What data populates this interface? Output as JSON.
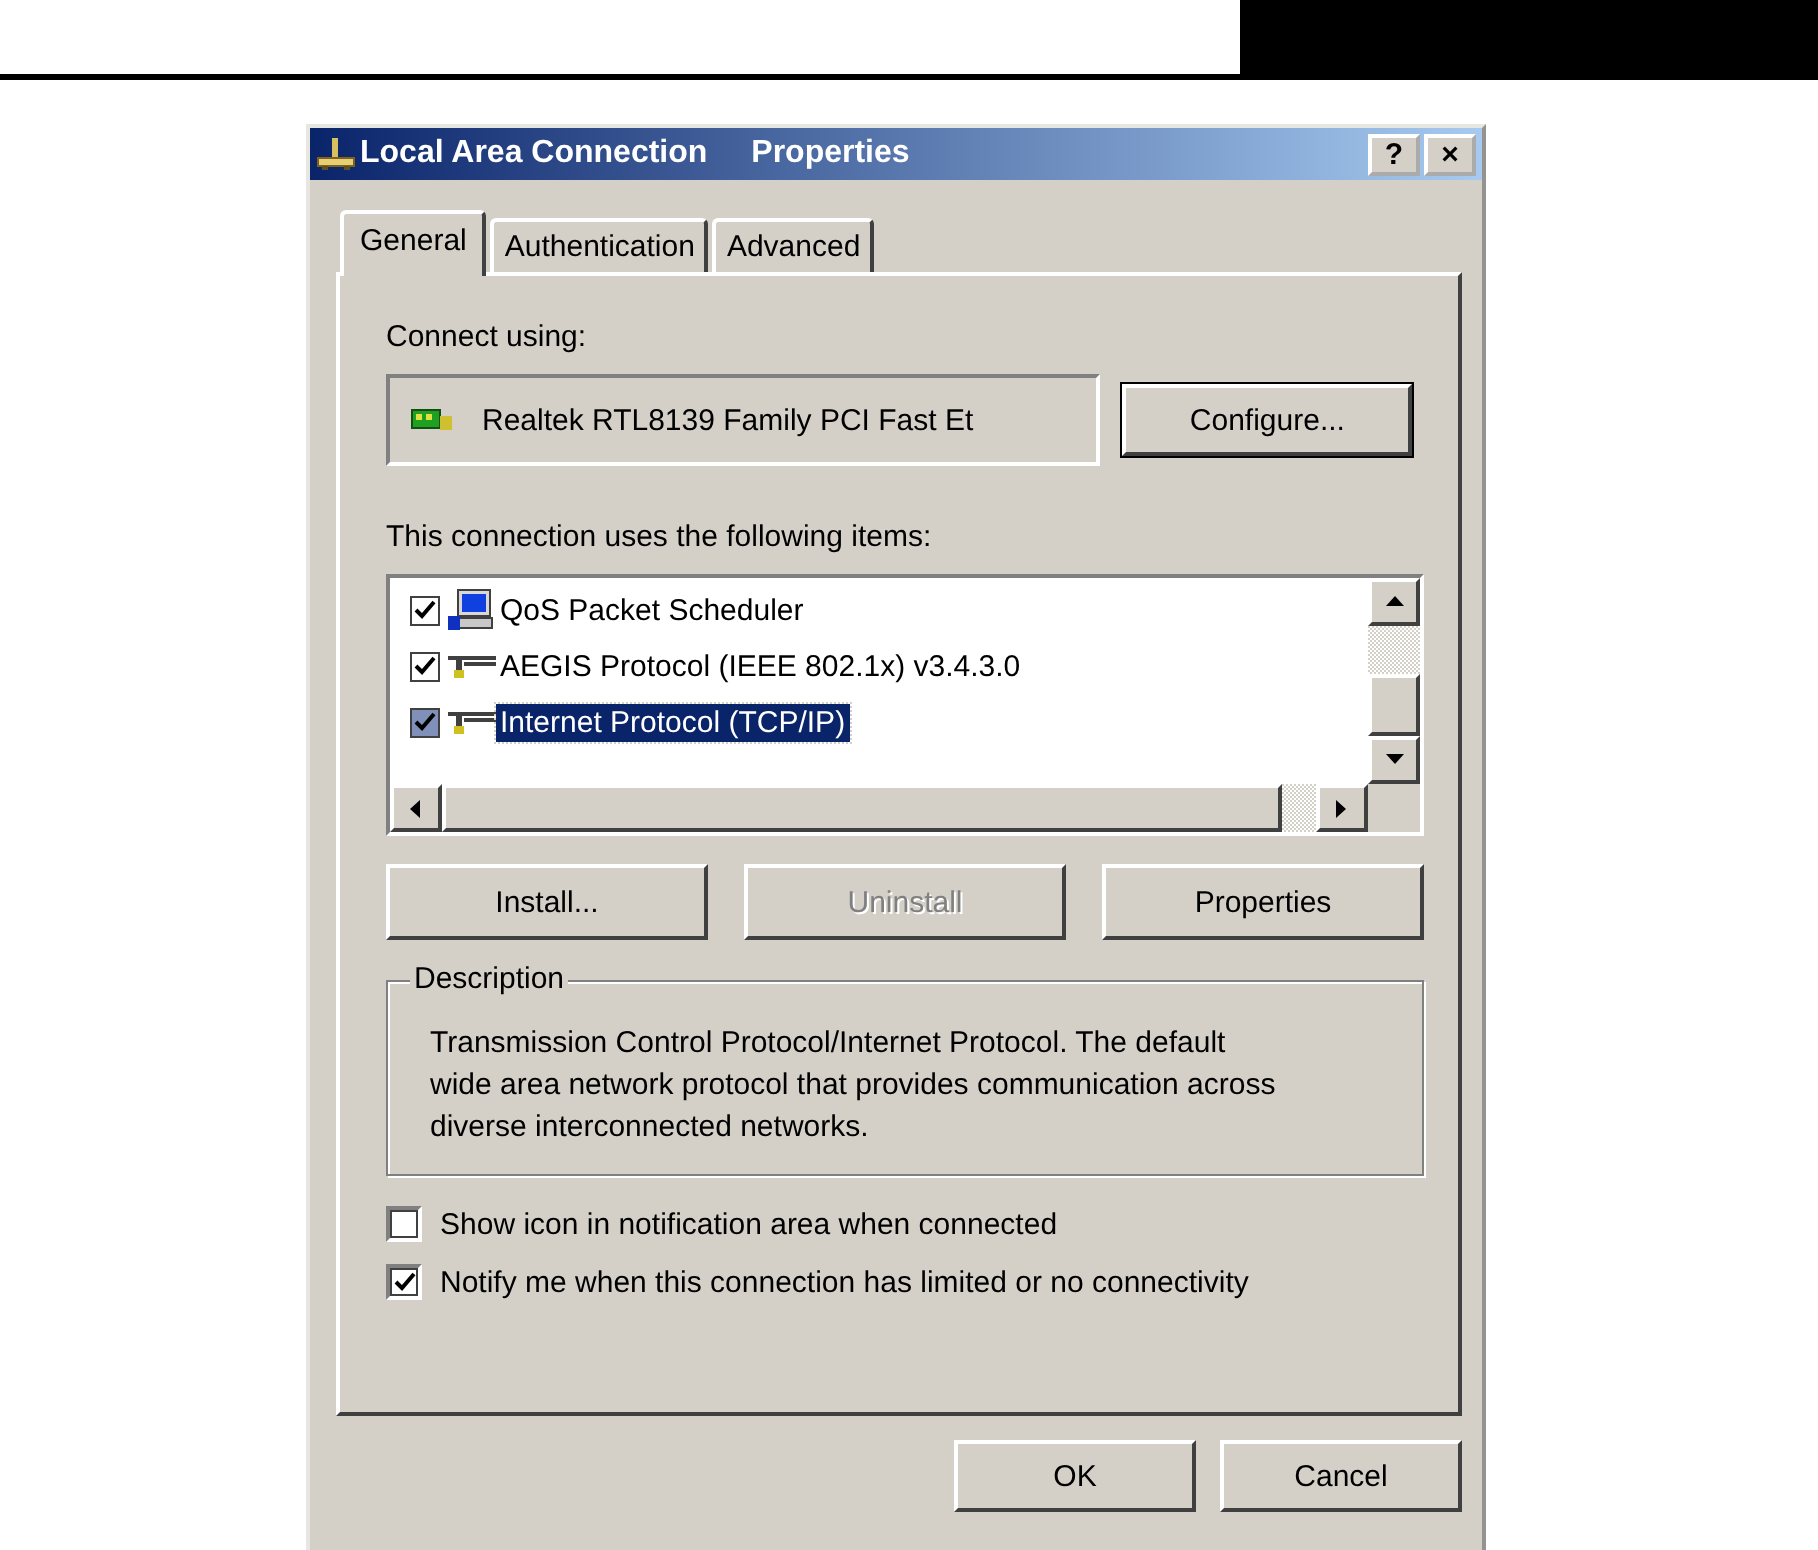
{
  "window": {
    "title": "Local Area Connection",
    "title_suffix": "Properties",
    "help_button": "?",
    "close_button": "×"
  },
  "tabs": [
    {
      "label": "General",
      "selected": true
    },
    {
      "label": "Authentication",
      "selected": false
    },
    {
      "label": "Advanced",
      "selected": false
    }
  ],
  "connect_using": {
    "label": "Connect using:",
    "adapter": "Realtek RTL8139 Family PCI Fast Et",
    "configure_button": "Configure..."
  },
  "components": {
    "label": "This connection uses the following items:",
    "items": [
      {
        "name": "QoS Packet Scheduler",
        "kind": "scheduler",
        "checked": true,
        "selected": false
      },
      {
        "name": "AEGIS Protocol (IEEE 802.1x) v3.4.3.0",
        "kind": "protocol",
        "checked": true,
        "selected": false
      },
      {
        "name": "Internet Protocol (TCP/IP)",
        "kind": "protocol",
        "checked": true,
        "selected": true
      }
    ]
  },
  "item_buttons": [
    {
      "label": "Install...",
      "disabled": false
    },
    {
      "label": "Uninstall",
      "disabled": true
    },
    {
      "label": "Properties",
      "disabled": false
    }
  ],
  "description": {
    "legend": "Description",
    "text": "Transmission Control Protocol/Internet Protocol. The default wide area network protocol that provides communication across diverse interconnected networks."
  },
  "options": [
    {
      "label": "Show icon in notification area when connected",
      "checked": false
    },
    {
      "label": "Notify me when this connection has limited or no connectivity",
      "checked": true
    }
  ],
  "footer_buttons": [
    "OK",
    "Cancel"
  ]
}
